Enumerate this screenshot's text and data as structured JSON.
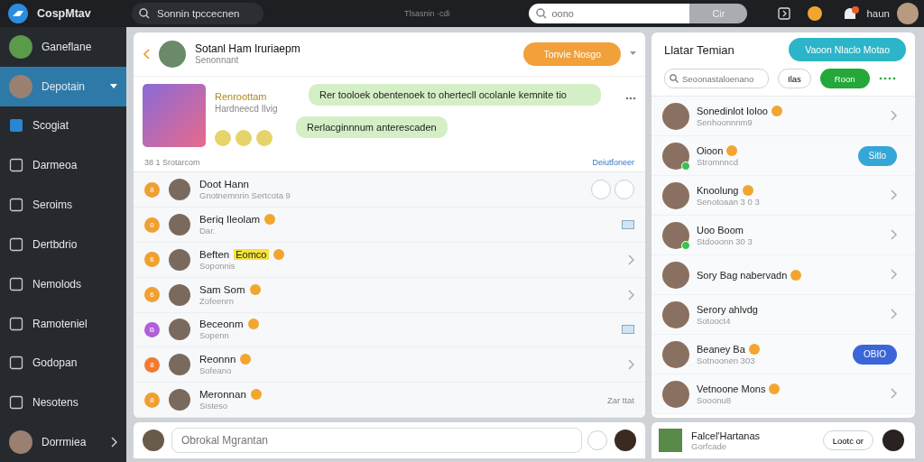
{
  "app": {
    "title": "CospMtav"
  },
  "sidebar": {
    "items": [
      {
        "label": "Ganeflane",
        "kind": "avatar",
        "selected": false
      },
      {
        "label": "Depotain",
        "kind": "avatar",
        "selected": true
      },
      {
        "label": "Scogiat",
        "kind": "app",
        "selected": false
      },
      {
        "label": "Darmeoa",
        "kind": "icon",
        "selected": false
      },
      {
        "label": "Seroims",
        "kind": "icon",
        "selected": false
      },
      {
        "label": "Dertbdrio",
        "kind": "icon",
        "selected": false
      },
      {
        "label": "Nemolods",
        "kind": "icon",
        "selected": false
      },
      {
        "label": "Ramoteniel",
        "kind": "icon",
        "selected": false
      },
      {
        "label": "Godopan",
        "kind": "icon",
        "selected": false
      },
      {
        "label": "Nesotens",
        "kind": "icon",
        "selected": false
      },
      {
        "label": "Dorrmiea",
        "kind": "profile",
        "selected": false
      }
    ]
  },
  "topbar": {
    "search": {
      "placeholder": "Sonnin tpccecnen"
    },
    "center_text": "Tlsasnin ·cdi",
    "search_field": {
      "placeholder": "oono"
    },
    "search_button": "Cir",
    "user_name": "haun"
  },
  "chat": {
    "header": {
      "name": "Sotanl Ham Iruriaepm",
      "subtitle": "Senonnant",
      "action_button": "Tonvie Nosgo"
    },
    "post": {
      "title": "Renroottam",
      "subtitle": "Hardneecd Ilvig",
      "messages": [
        "Rer tooloek obentenoek to ohertecll ocolanle kemnite tio",
        "Rerlacginnnum anterescaden"
      ],
      "footer": "38 1 Srotarcom",
      "link": "Deiutfoneer"
    },
    "conversations": [
      {
        "badge": "8",
        "color": "#f0a030",
        "name": "Doot Hann",
        "subtitle": "Gnotnemnrin Sertcota 9",
        "kind": "actions",
        "emoji": false
      },
      {
        "badge": "0",
        "color": "#f0a030",
        "name": "Beriq Ileolam",
        "subtitle": "Dar.",
        "kind": "icon",
        "emoji": true
      },
      {
        "badge": "6",
        "color": "#f0a030",
        "name": "Beften",
        "tag": "Eomco",
        "subtitle": "Soponnis",
        "kind": "chevron",
        "emoji": true
      },
      {
        "badge": "6",
        "color": "#f0a030",
        "name": "Sam Som",
        "subtitle": "Zofeenrn",
        "kind": "chevron",
        "emoji": true
      },
      {
        "badge": "B",
        "color": "#b060d8",
        "name": "Beceonm",
        "subtitle": "Sopenn",
        "kind": "icon",
        "emoji": true
      },
      {
        "badge": "8",
        "color": "#f07a30",
        "name": "Reonnn",
        "subtitle": "Sofeano",
        "kind": "chevron",
        "emoji": true
      },
      {
        "badge": "8",
        "color": "#f0a030",
        "name": "Meronnan",
        "subtitle": "Sisteso",
        "kind": "text",
        "trailing_text": "Zar ttat",
        "emoji": true
      }
    ],
    "composer": {
      "placeholder": "Obrokal Mgrantan"
    }
  },
  "friends": {
    "title": "Llatar Temian",
    "add_button": "Vaoon Nlaclo Motao",
    "search": {
      "placeholder": "Seoonastaloenano"
    },
    "filter_button": "Ilas",
    "online_button": "Roon",
    "items": [
      {
        "name": "Sonedinlot Ioloo",
        "subtitle": "Senhoonnnm9",
        "kind": "chevron",
        "online": false,
        "emoji": true
      },
      {
        "name": "Oioon",
        "subtitle": "Stromnncd",
        "kind": "button",
        "button": "Sitlo",
        "online": true,
        "emoji": true
      },
      {
        "name": "Knoolung",
        "subtitle": "Senotoaan 3 0 3",
        "kind": "chevron",
        "online": false,
        "emoji": true
      },
      {
        "name": "Uoo Boom",
        "subtitle": "Stdooonn 30 3",
        "kind": "chevron",
        "online": true,
        "emoji": false
      },
      {
        "name": "Sory Bag nabervadn",
        "kind": "chevron",
        "online": false,
        "emoji": true
      },
      {
        "name": "Serory ahlvdg",
        "subtitle": "Sotooct4",
        "kind": "chevron",
        "online": false,
        "emoji": false
      },
      {
        "name": "Beaney Ba",
        "subtitle": "Sotnoonen 303",
        "kind": "button",
        "button": "OBIO",
        "online": false,
        "emoji": true
      },
      {
        "name": "Vetnoone Mons",
        "subtitle": "Sooonu8",
        "kind": "chevron",
        "online": false,
        "emoji": true
      }
    ],
    "card": {
      "name": "Falcel'Hartanas",
      "subtitle": "Gorfcade",
      "button": "Lootc or"
    }
  }
}
